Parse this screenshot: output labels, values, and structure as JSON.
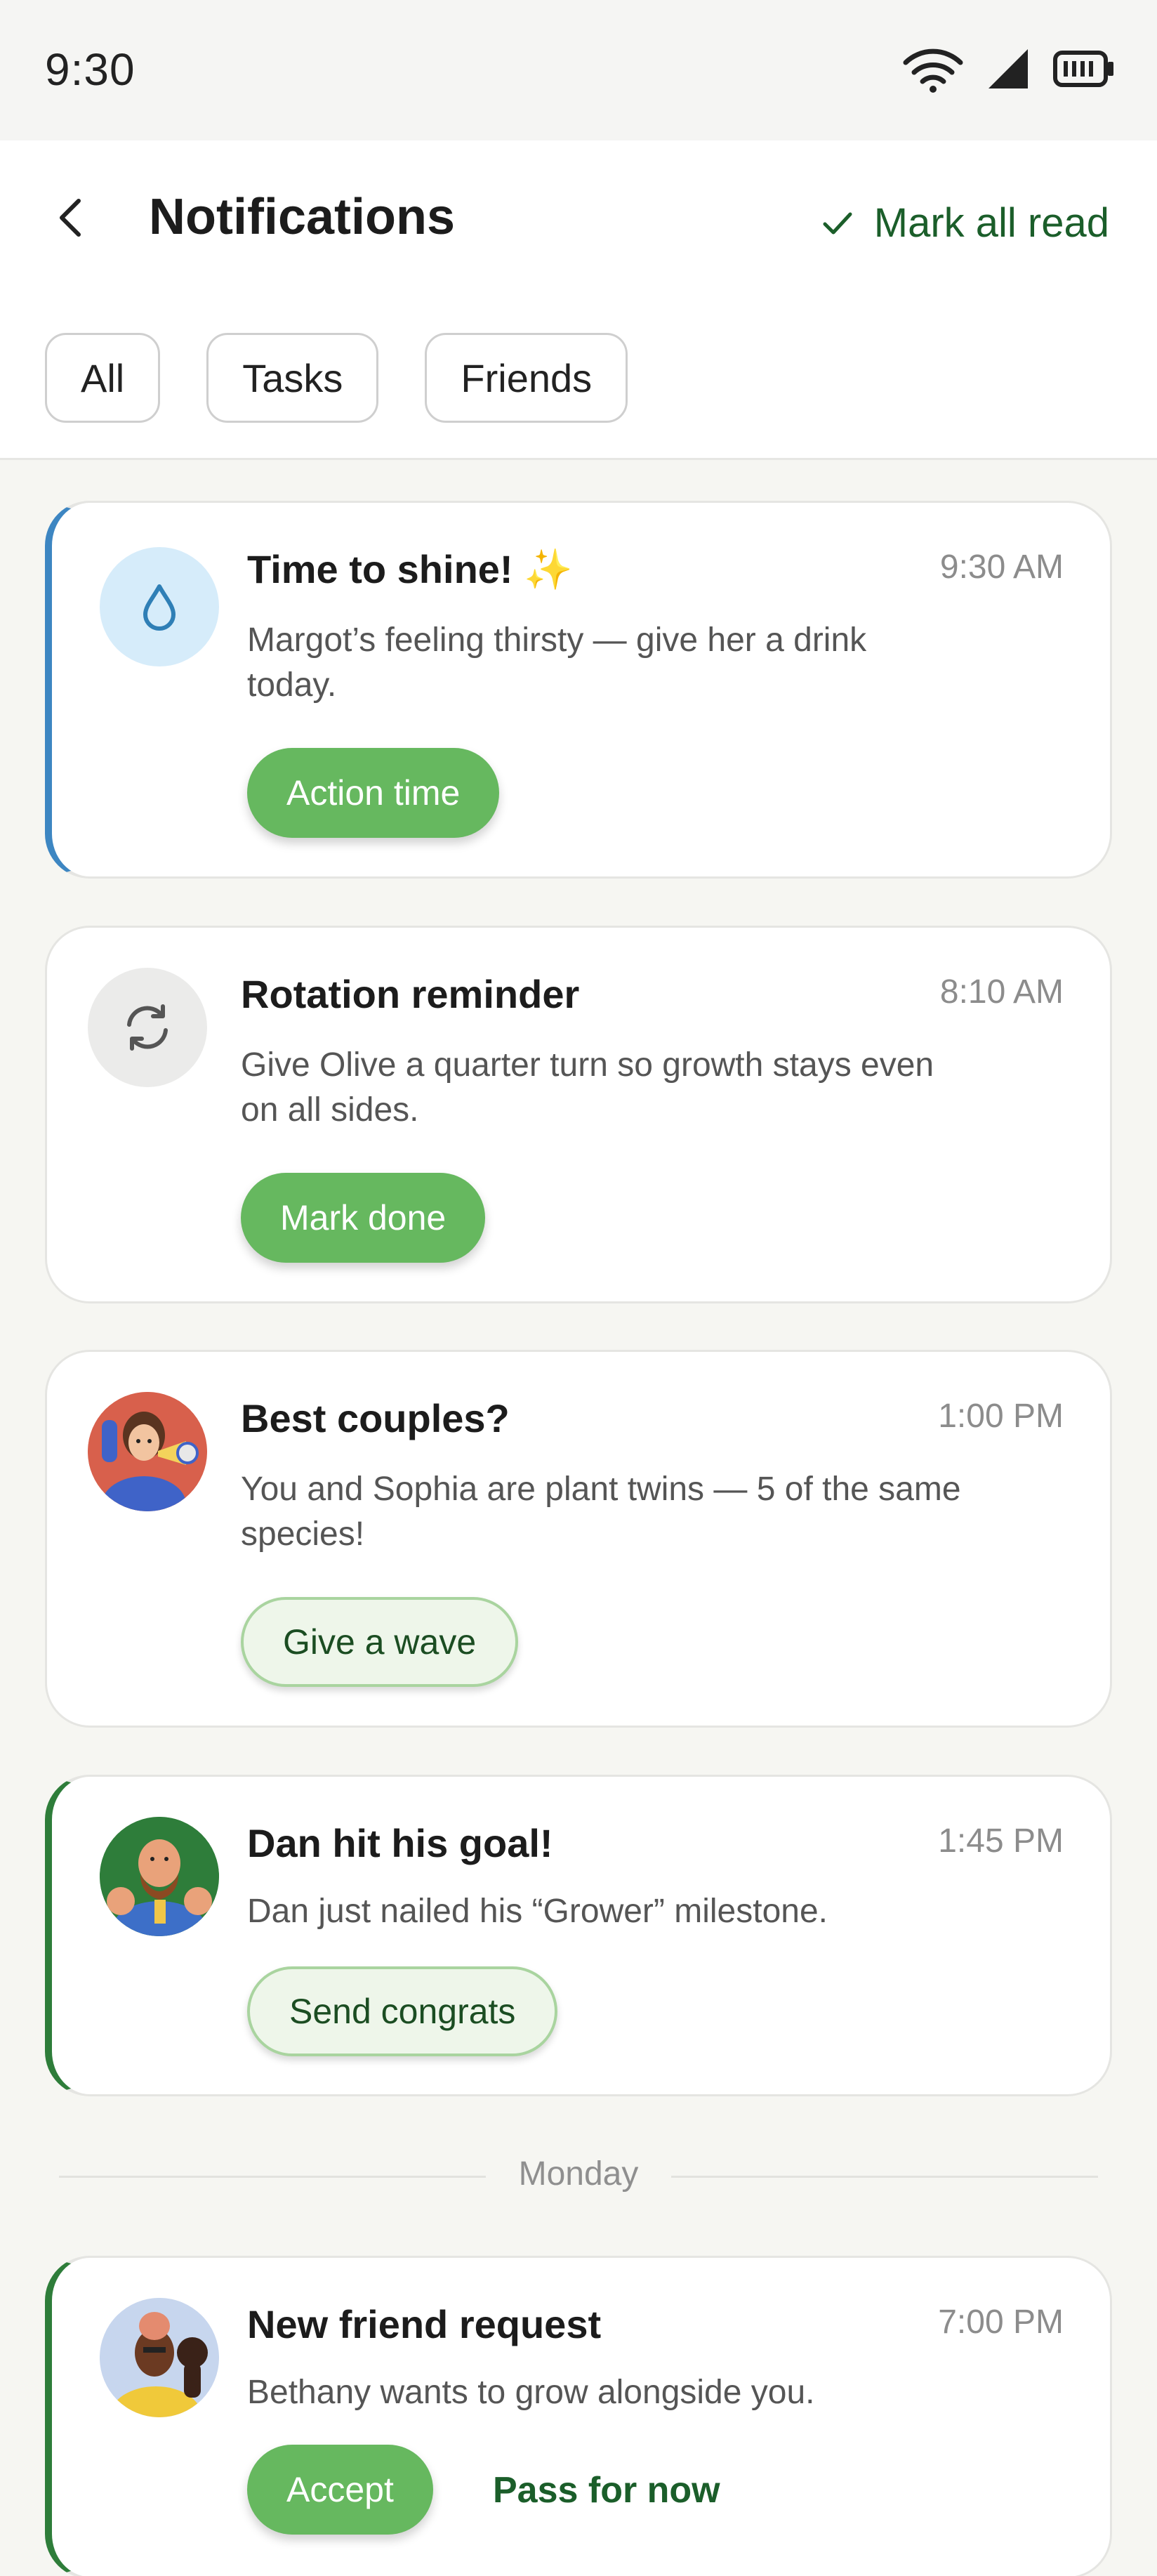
{
  "status": {
    "time": "9:30"
  },
  "header": {
    "title": "Notifications",
    "mark_all_label": "Mark all read"
  },
  "filters": [
    "All",
    "Tasks",
    "Friends"
  ],
  "notifications": [
    {
      "title": "Time to shine! ✨",
      "time": "9:30 AM",
      "body": "Margot’s feeling thirsty — give her a drink today.",
      "action": "Action time",
      "icon": "water-drop-icon",
      "accent": "#3d86c2"
    },
    {
      "title": "Rotation reminder",
      "time": "8:10 AM",
      "body": "Give Olive a quarter turn so growth stays even on all sides.",
      "action": "Mark done",
      "icon": "rotate-icon"
    },
    {
      "title": "Best couples?",
      "time": "1:00 PM",
      "body": "You and Sophia are plant twins — 5 of the same species!",
      "action": "Give a wave",
      "icon": "avatar"
    },
    {
      "title": "Dan hit his goal!",
      "time": "1:45 PM",
      "body": "Dan just nailed his “Grower” milestone.",
      "action": "Send congrats",
      "icon": "avatar",
      "accent": "#2e7d3a"
    },
    {
      "title": "New friend request",
      "time": "7:00 PM",
      "body": "Bethany wants to grow alongside you.",
      "action": "Accept",
      "secondary_action": "Pass for now",
      "icon": "avatar",
      "accent": "#2e7d3a"
    }
  ],
  "divider": {
    "label": "Monday"
  },
  "colors": {
    "primary_button": "#66b85f",
    "brand_green": "#1b5e2a",
    "accent_blue": "#3d86c2"
  }
}
